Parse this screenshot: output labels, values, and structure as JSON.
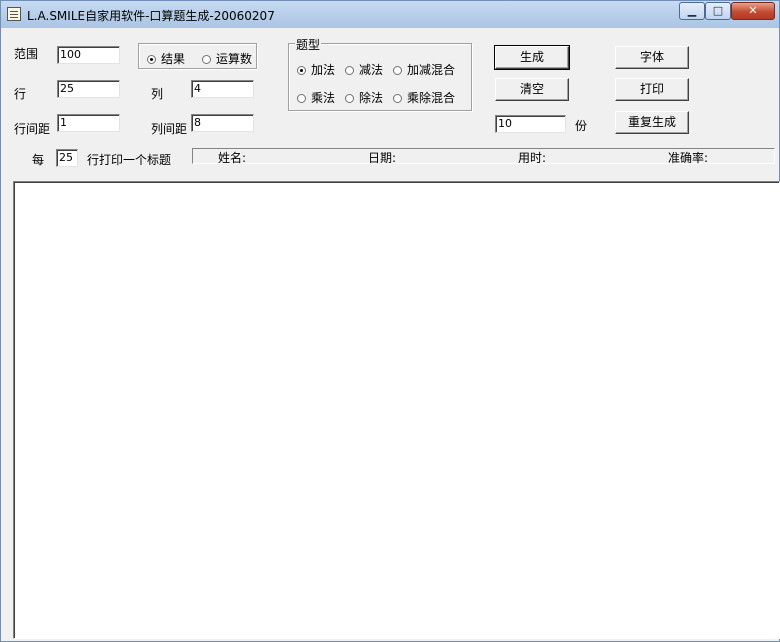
{
  "window": {
    "title": "L.A.SMILE自家用软件-口算题生成-20060207",
    "minimize_glyph": "▁",
    "maximize_glyph": "□",
    "close_glyph": "✕",
    "icon": "scroll-icon"
  },
  "form": {
    "range_label": "范围",
    "range_value": "100",
    "rows_label": "行",
    "rows_value": "25",
    "cols_label": "列",
    "cols_value": "4",
    "row_spacing_label": "行间距",
    "row_spacing_value": "1",
    "col_spacing_label": "列间距",
    "col_spacing_value": "8",
    "per_label": "每",
    "per_value": "25",
    "per_suffix": "行打印一个标题"
  },
  "answer_mode": {
    "options": [
      "结果",
      "运算数"
    ],
    "selected": "结果"
  },
  "question_type": {
    "group_label": "题型",
    "options": [
      "加法",
      "减法",
      "加减混合",
      "乘法",
      "除法",
      "乘除混合"
    ],
    "selected": "加法"
  },
  "buttons": {
    "generate": "生成",
    "clear": "清空",
    "font": "字体",
    "print": "打印",
    "repeat_generate": "重复生成"
  },
  "copies": {
    "value": "10",
    "unit": "份"
  },
  "header_fields": {
    "name": "姓名:",
    "date": "日期:",
    "time_used": "用时:",
    "accuracy": "准确率:"
  }
}
